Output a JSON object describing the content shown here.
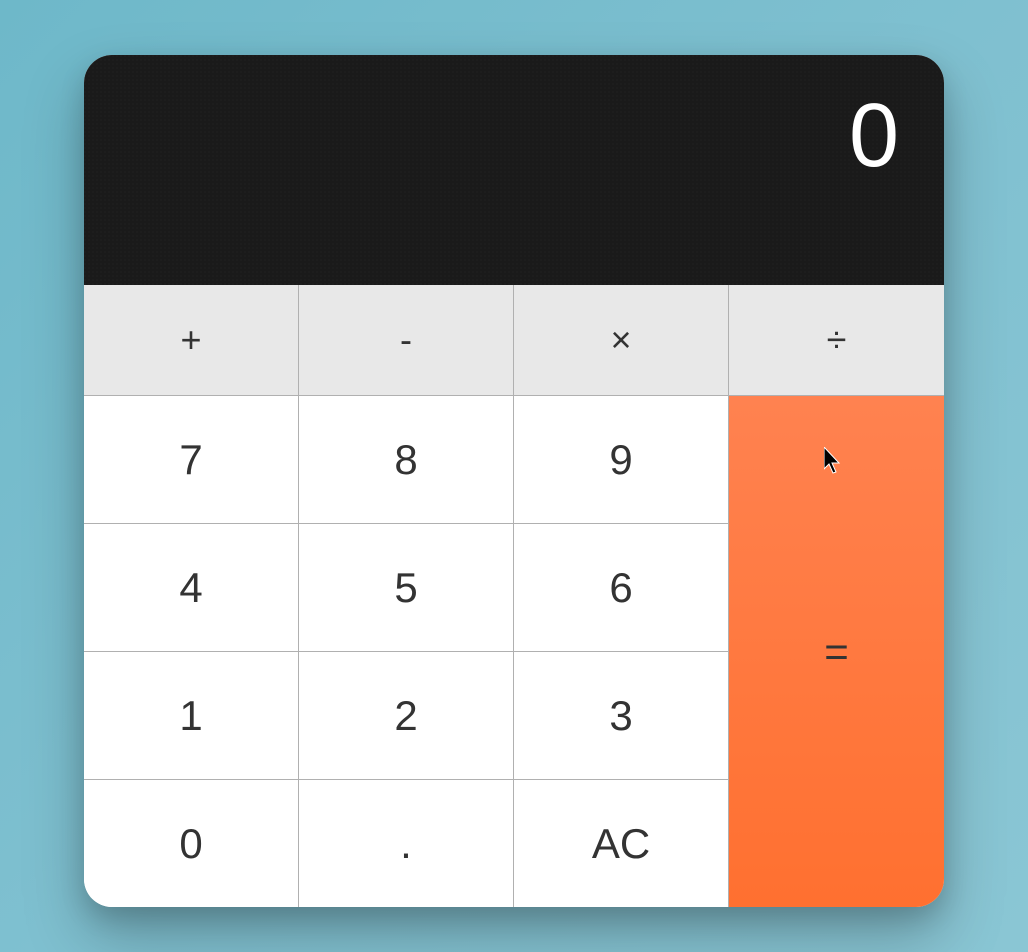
{
  "display": {
    "value": "0"
  },
  "operators": {
    "add": "+",
    "subtract": "-",
    "multiply": "×",
    "divide": "÷"
  },
  "keypad": {
    "n7": "7",
    "n8": "8",
    "n9": "9",
    "n4": "4",
    "n5": "5",
    "n6": "6",
    "n1": "1",
    "n2": "2",
    "n3": "3",
    "n0": "0",
    "decimal": ".",
    "clear": "AC",
    "equals": "="
  }
}
